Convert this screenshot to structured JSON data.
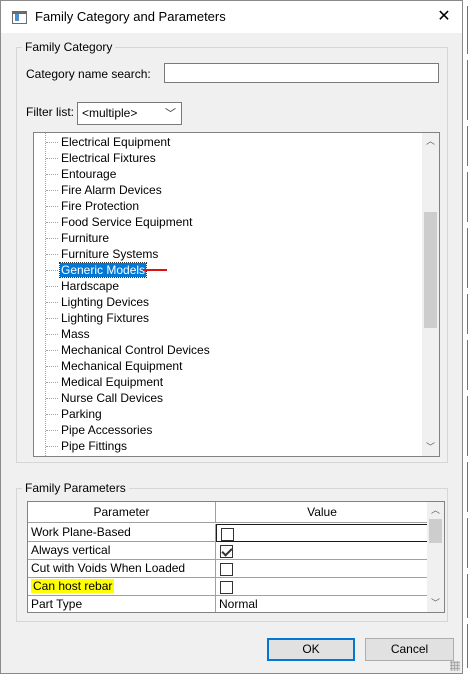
{
  "window": {
    "title": "Family Category and Parameters",
    "close_glyph": "✕"
  },
  "family_category": {
    "group_label": "Family Category",
    "search_label": "Category name search:",
    "search_value": "",
    "filter_label": "Filter list:",
    "filter_selected": "<multiple>",
    "selected_item": "Generic Models",
    "items": [
      "Electrical Equipment",
      "Electrical Fixtures",
      "Entourage",
      "Fire Alarm Devices",
      "Fire Protection",
      "Food Service Equipment",
      "Furniture",
      "Furniture Systems",
      "Generic Models",
      "Hardscape",
      "Lighting Devices",
      "Lighting Fixtures",
      "Mass",
      "Mechanical Control Devices",
      "Mechanical Equipment",
      "Medical Equipment",
      "Nurse Call Devices",
      "Parking",
      "Pipe Accessories",
      "Pipe Fittings"
    ]
  },
  "family_parameters": {
    "group_label": "Family Parameters",
    "columns": [
      "Parameter",
      "Value"
    ],
    "rows": [
      {
        "parameter": "Work Plane-Based",
        "type": "checkbox",
        "checked": false,
        "highlighted": false
      },
      {
        "parameter": "Always vertical",
        "type": "checkbox",
        "checked": true,
        "highlighted": false
      },
      {
        "parameter": "Cut with Voids When Loaded",
        "type": "checkbox",
        "checked": false,
        "highlighted": false
      },
      {
        "parameter": "Can host rebar",
        "type": "checkbox",
        "checked": false,
        "highlighted": true
      },
      {
        "parameter": "Part Type",
        "type": "text",
        "value": "Normal",
        "highlighted": false
      }
    ]
  },
  "buttons": {
    "ok": "OK",
    "cancel": "Cancel"
  },
  "colors": {
    "selection": "#0078d7",
    "highlight": "#ffff00",
    "annotation_mark": "#e01010"
  }
}
